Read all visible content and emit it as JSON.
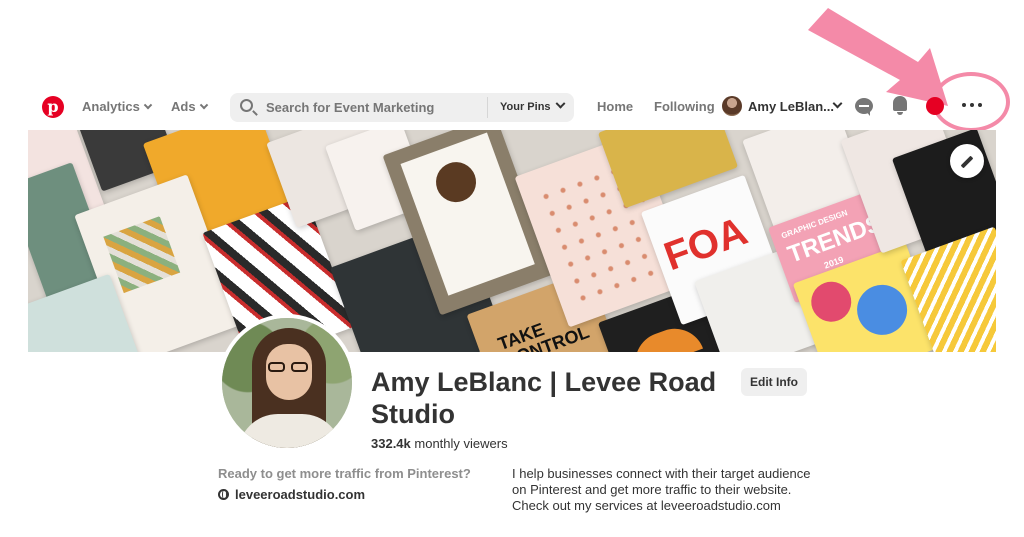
{
  "nav": {
    "analytics_label": "Analytics",
    "ads_label": "Ads",
    "search_placeholder": "Search for Event Marketing",
    "search_scope": "Your Pins",
    "home_label": "Home",
    "following_label": "Following",
    "user_name": "Amy LeBlan..."
  },
  "cover": {
    "tiles": {
      "trends_title": "TRENDS",
      "trends_sub": "GRAPHIC DESIGN",
      "trends_year": "2019",
      "foa": "FOA",
      "take_control": "TAKE CONTROL"
    }
  },
  "profile": {
    "name": "Amy LeBlanc | Levee Road Studio",
    "edit_label": "Edit Info",
    "viewers_count": "332.4k",
    "viewers_label": "monthly viewers",
    "tagline": "Ready to get more traffic from Pinterest?",
    "website": "leveeroadstudio.com",
    "bio": "I help businesses connect with their target audience on Pinterest and get more traffic to their website. Check out my services at leveeroadstudio.com"
  },
  "colors": {
    "brand": "#e60023",
    "annotation": "#f48aa8"
  }
}
